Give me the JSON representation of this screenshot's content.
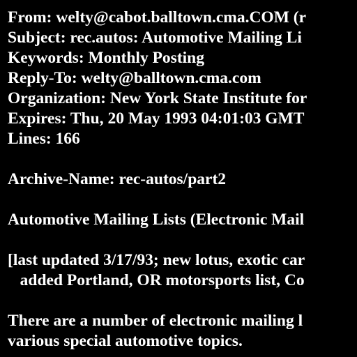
{
  "headers": {
    "from": "From: welty@cabot.balltown.cma.COM (r",
    "subject": "Subject: rec.autos: Automotive Mailing Li",
    "keywords": "Keywords: Monthly Posting",
    "reply_to": "Reply-To: welty@balltown.cma.com",
    "organization": "Organization: New York State Institute for",
    "expires": "Expires: Thu, 20 May 1993 04:01:03 GMT",
    "lines": "Lines: 166"
  },
  "body": {
    "archive_name": "Archive-Name: rec-autos/part2",
    "heading": "Automotive Mailing Lists (Electronic Mail",
    "update_note_1": "[last updated 3/17/93; new lotus, exotic car",
    "update_note_2": "   added Portland, OR motorsports list, Co",
    "intro_1": "There are a number of electronic mailing l",
    "intro_2": "various special automotive topics."
  },
  "colors": {
    "background": "#000000",
    "text": "#ffffff"
  }
}
